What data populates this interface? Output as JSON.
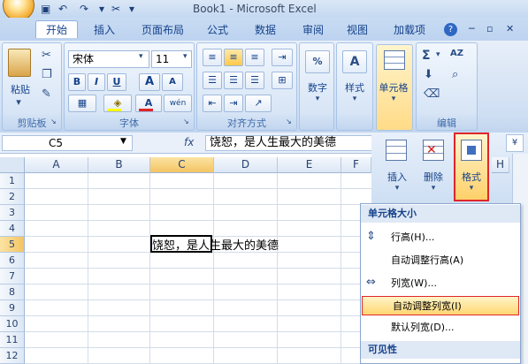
{
  "window": {
    "title": "Book1 - Microsoft Excel"
  },
  "tabs": [
    {
      "label": "开始"
    },
    {
      "label": "插入"
    },
    {
      "label": "页面布局"
    },
    {
      "label": "公式"
    },
    {
      "label": "数据"
    },
    {
      "label": "审阅"
    },
    {
      "label": "视图"
    },
    {
      "label": "加载项"
    }
  ],
  "clipboard": {
    "paste": "粘贴",
    "group": "剪贴板"
  },
  "font": {
    "name": "宋体",
    "size": "11",
    "group": "字体",
    "grow": "A",
    "shrink": "A",
    "bold": "B",
    "italic": "I",
    "underline": "U",
    "color_a": "A",
    "phonetic": "wén"
  },
  "alignment": {
    "group": "对齐方式"
  },
  "number": {
    "label": "数字",
    "symbol": "%"
  },
  "styles": {
    "label": "样式",
    "symbol": "A"
  },
  "cells": {
    "label": "单元格"
  },
  "editing": {
    "group": "编辑",
    "sum": "Σ",
    "sort": "AZ"
  },
  "cells_panel": {
    "insert": "插入",
    "delete": "删除",
    "format": "格式"
  },
  "formula_bar": {
    "name_box": "C5",
    "fx": "fx",
    "content": "饶恕，是人生最大的美德"
  },
  "columns": [
    "A",
    "B",
    "C",
    "D",
    "E",
    "F"
  ],
  "extra_col": "H",
  "rows": [
    "1",
    "2",
    "3",
    "4",
    "5",
    "6",
    "7",
    "8",
    "9",
    "10",
    "11",
    "12"
  ],
  "cell_c5": "饶恕，是人生最大的美德",
  "menu": {
    "header1": "单元格大小",
    "items": [
      {
        "label": "行高(H)..."
      },
      {
        "label": "自动调整行高(A)"
      },
      {
        "label": "列宽(W)..."
      },
      {
        "label": "自动调整列宽(I)"
      },
      {
        "label": "默认列宽(D)..."
      }
    ],
    "header2": "可见性"
  },
  "help": "?"
}
